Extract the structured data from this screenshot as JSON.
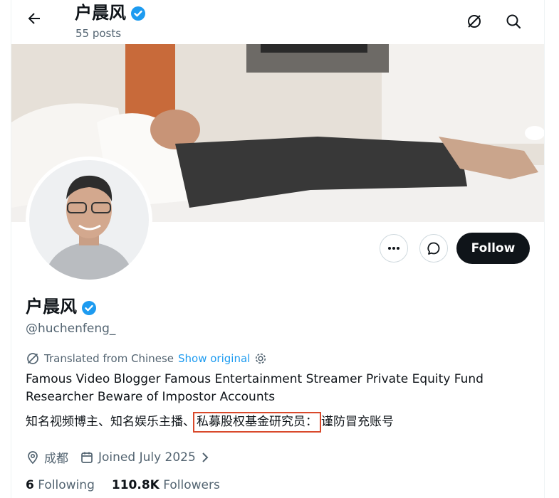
{
  "header": {
    "name": "户晨风",
    "posts": "55 posts"
  },
  "profile": {
    "name": "户晨风",
    "handle": "@huchenfeng_",
    "follow_label": "Follow"
  },
  "translation": {
    "label": "Translated from Chinese",
    "show_original": "Show original"
  },
  "bio": {
    "en_line1": "Famous Video Blogger  Famous Entertainment Streamer  Private Equity Fund",
    "en_line2": "Researcher  Beware of Impostor Accounts",
    "zh_part1": "知名视频博主、知名娱乐主播、",
    "zh_highlight": "私募股权基金研究员：",
    "zh_part2": "谨防冒充账号"
  },
  "meta": {
    "location": "成都",
    "joined": "Joined July 2025"
  },
  "stats": {
    "following_count": "6",
    "following_label": "Following",
    "followers_count": "110.8K",
    "followers_label": "Followers"
  },
  "colors": {
    "verified": "#1d9bf0",
    "highlight_box": "#d9492b",
    "follow_bg": "#0f1419"
  }
}
